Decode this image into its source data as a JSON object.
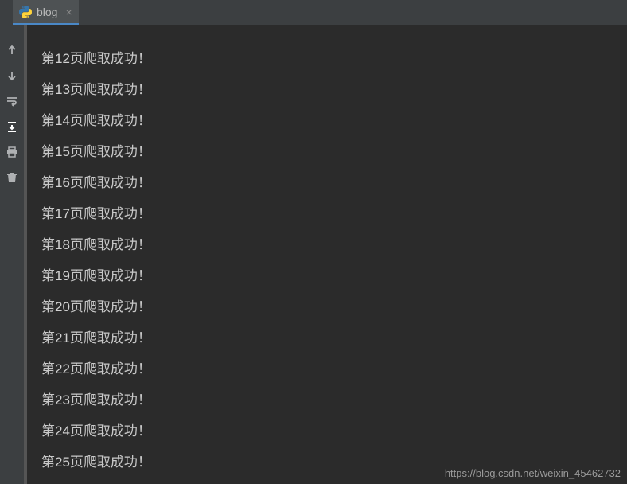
{
  "tab": {
    "label": "blog",
    "close_glyph": "×"
  },
  "gutter": {
    "icons": [
      {
        "name": "arrow-up-icon"
      },
      {
        "name": "arrow-down-icon"
      },
      {
        "name": "wrap-icon"
      },
      {
        "name": "scroll-to-end-icon"
      },
      {
        "name": "print-icon"
      },
      {
        "name": "trash-icon"
      }
    ]
  },
  "output": {
    "prefix": "第",
    "suffix": "页爬取成功！",
    "lines": [
      {
        "num": "12"
      },
      {
        "num": "13"
      },
      {
        "num": "14"
      },
      {
        "num": "15"
      },
      {
        "num": "16"
      },
      {
        "num": "17"
      },
      {
        "num": "18"
      },
      {
        "num": "19"
      },
      {
        "num": "20"
      },
      {
        "num": "21"
      },
      {
        "num": "22"
      },
      {
        "num": "23"
      },
      {
        "num": "24"
      },
      {
        "num": "25"
      }
    ]
  },
  "watermark": "https://blog.csdn.net/weixin_45462732"
}
